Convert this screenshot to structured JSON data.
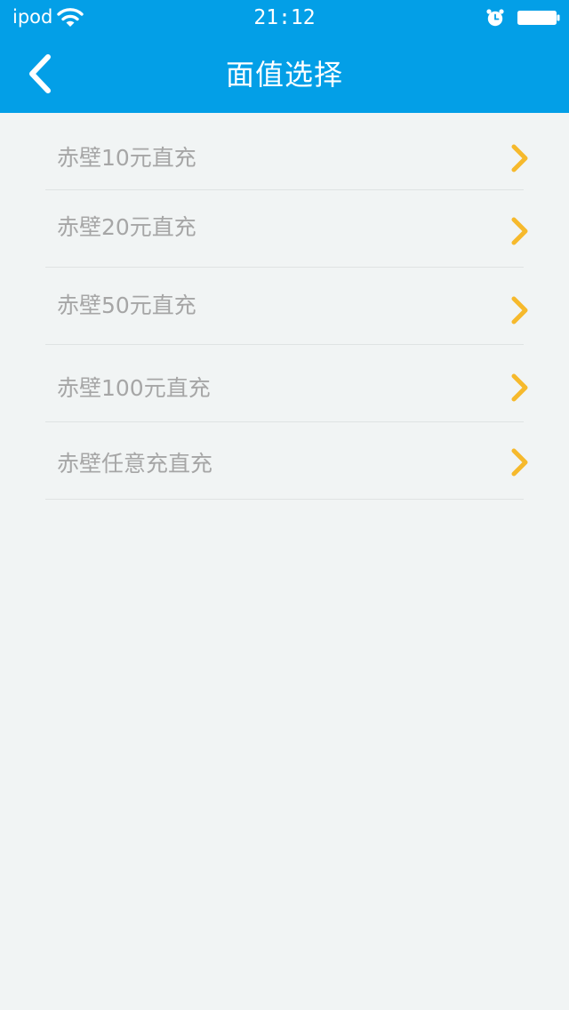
{
  "status_bar": {
    "carrier": "ipod",
    "time": "21:12",
    "icons": [
      "wifi-icon",
      "alarm-icon",
      "battery-icon"
    ]
  },
  "nav": {
    "title": "面值选择",
    "back_icon": "chevron-left-icon"
  },
  "options": [
    {
      "label": "赤壁10元直充"
    },
    {
      "label": "赤壁20元直充"
    },
    {
      "label": "赤壁50元直充"
    },
    {
      "label": "赤壁100元直充"
    },
    {
      "label": "赤壁任意充直充"
    }
  ],
  "colors": {
    "header_background": "#039fe7",
    "page_background": "#f1f4f4",
    "label_text": "#a6a6a6",
    "chevron": "#f6b92c",
    "divider": "#dfe3e3"
  }
}
